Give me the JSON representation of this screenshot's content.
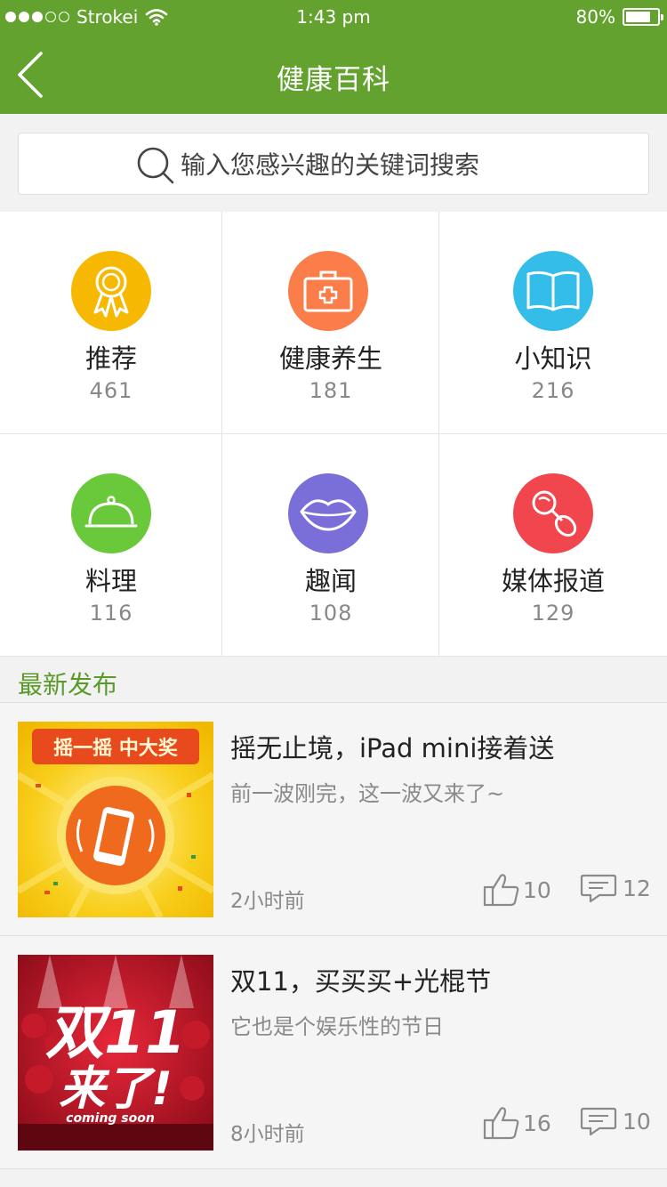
{
  "status_bar": {
    "carrier": "Strokei",
    "time": "1:43 pm",
    "battery": "80%",
    "battery_level": 0.8
  },
  "nav": {
    "title": "健康百科"
  },
  "search": {
    "placeholder": "输入您感兴趣的关键词搜索"
  },
  "categories": [
    {
      "name": "推荐",
      "count": "461",
      "icon": "ribbon-icon",
      "color": "#f6b800"
    },
    {
      "name": "健康养生",
      "count": "181",
      "icon": "medical-kit-icon",
      "color": "#fb7d4a"
    },
    {
      "name": "小知识",
      "count": "216",
      "icon": "book-icon",
      "color": "#33bde8"
    },
    {
      "name": "料理",
      "count": "116",
      "icon": "cloche-icon",
      "color": "#69c93a"
    },
    {
      "name": "趣闻",
      "count": "108",
      "icon": "lips-icon",
      "color": "#7a6fd8"
    },
    {
      "name": "媒体报道",
      "count": "129",
      "icon": "pacifier-icon",
      "color": "#f1464d"
    }
  ],
  "latest": {
    "title": "最新发布",
    "items": [
      {
        "title": "摇无止境，iPad mini接着送",
        "desc": "前一波刚完，这一波又来了~",
        "time": "2小时前",
        "likes": "10",
        "comments": "12",
        "thumb_text": "摇一摇 中大奖"
      },
      {
        "title": "双11，买买买+光棍节",
        "desc": "它也是个娱乐性的节日",
        "time": "8小时前",
        "likes": "16",
        "comments": "10",
        "thumb_text_main": "双11",
        "thumb_text_sub": "来了!",
        "thumb_text_en": "coming soon"
      }
    ]
  },
  "colors": {
    "brand": "#64a230",
    "section_title": "#5a9a2a"
  }
}
